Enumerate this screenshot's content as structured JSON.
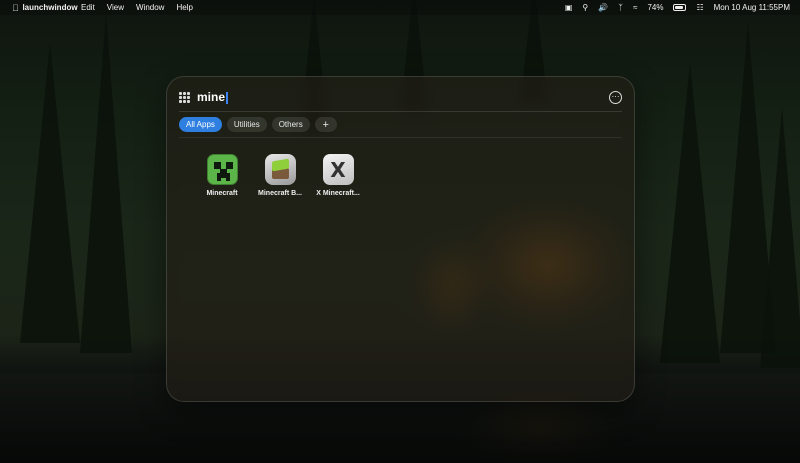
{
  "menubar": {
    "app_name": "launchwindow",
    "menus": [
      "Edit",
      "View",
      "Window",
      "Help"
    ],
    "battery_percent": "74%",
    "datetime": "Mon 10 Aug  11:55PM"
  },
  "launcher": {
    "search_value": "mine",
    "tabs": [
      "All Apps",
      "Utilities",
      "Others",
      "+"
    ],
    "active_tab": "All Apps",
    "apps": [
      {
        "label": "Minecraft",
        "icon": "minecraft-creeper-icon"
      },
      {
        "label": "Minecraft B...",
        "icon": "minecraft-bedrock-icon"
      },
      {
        "label": "X Minecraft...",
        "icon": "x-minecraft-icon"
      }
    ]
  },
  "colors": {
    "accent": "#2f7fe0",
    "caret": "#3b82f6"
  }
}
